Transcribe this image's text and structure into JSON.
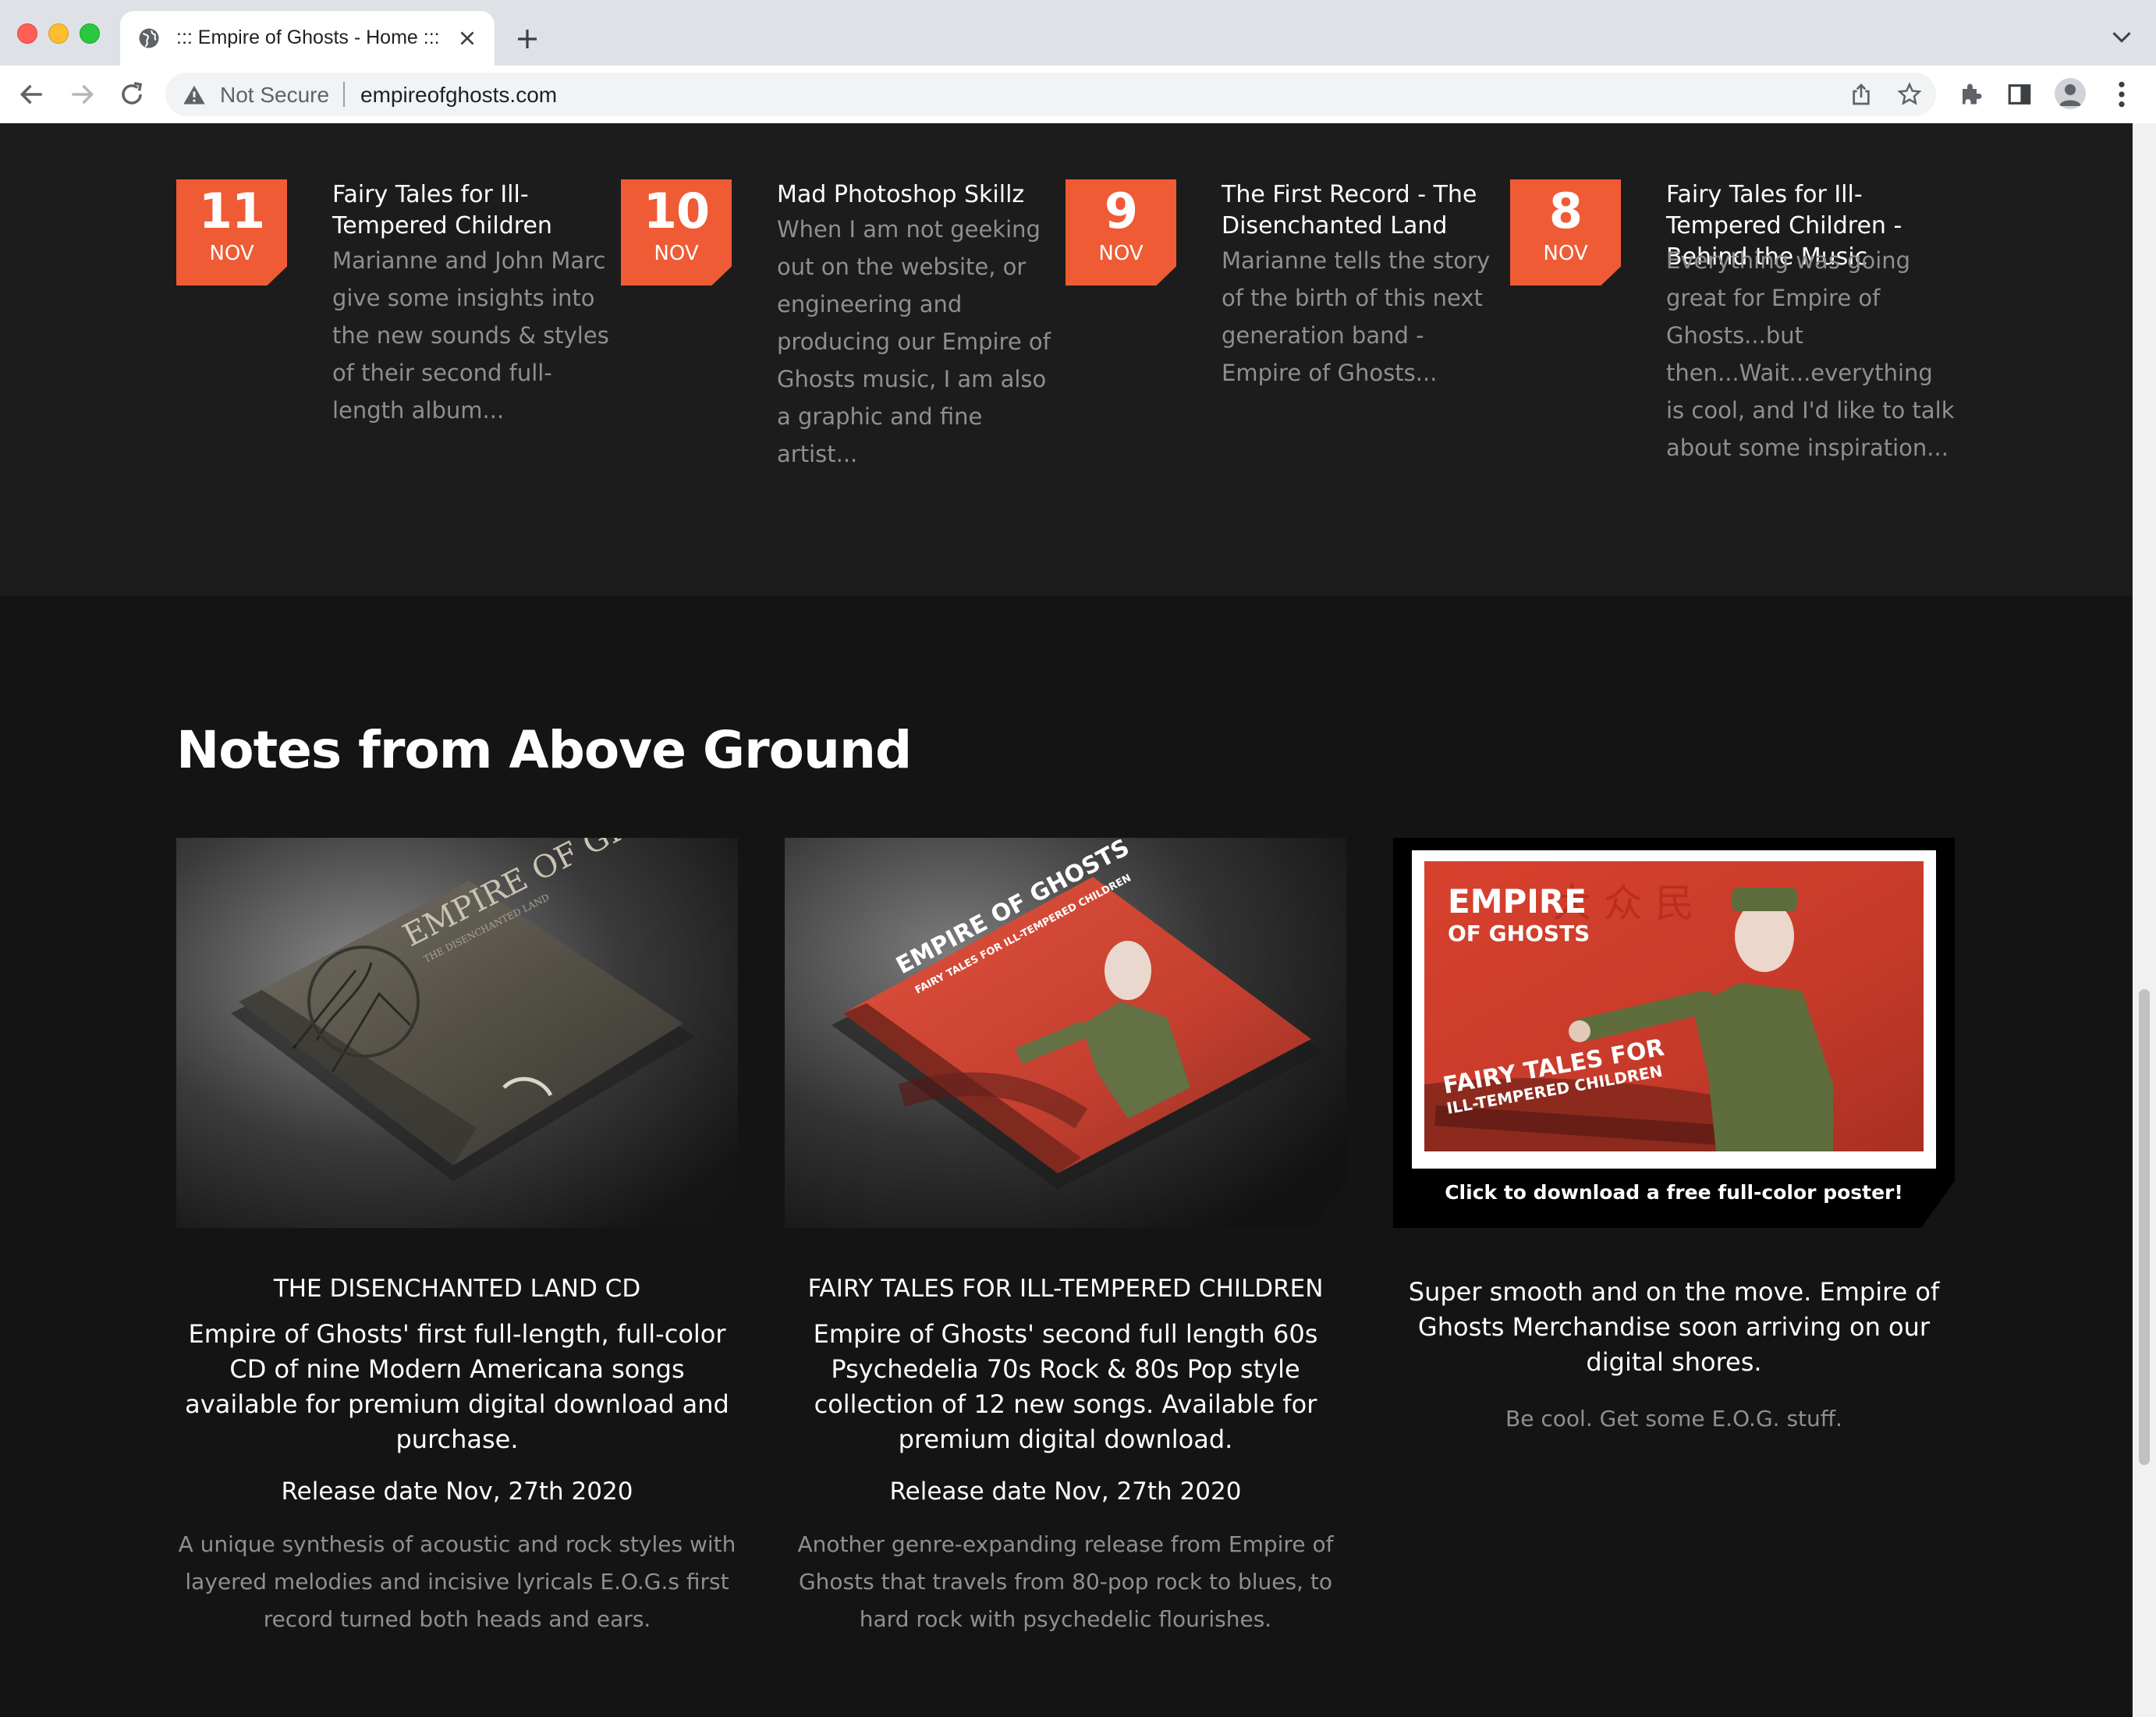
{
  "browser": {
    "tab_title": "::: Empire of Ghosts - Home :::",
    "security_label": "Not Secure",
    "url": "empireofghosts.com"
  },
  "posts": [
    {
      "day": "11",
      "month": "NOV",
      "title": "Fairy Tales for Ill-Tempered Children",
      "excerpt": "Marianne and John Marc give some insights into the new sounds & styles of their second full-length album..."
    },
    {
      "day": "10",
      "month": "NOV",
      "title": "Mad Photoshop Skillz",
      "excerpt": "When I am not geeking out on the website, or engineering and producing our Empire of Ghosts music, I am also a graphic and fine artist..."
    },
    {
      "day": "9",
      "month": "NOV",
      "title": "The First Record - The Disenchanted Land",
      "excerpt": "Marianne tells the story of the birth of this next generation band - Empire of Ghosts..."
    },
    {
      "day": "8",
      "month": "NOV",
      "title": "Fairy Tales for Ill-Tempered Children - Behind the Music",
      "excerpt": "Everything was going great for Empire of Ghosts...but then...Wait...everything is cool, and I'd like to talk about some inspiration..."
    }
  ],
  "notes": {
    "heading": "Notes from Above Ground",
    "cards": [
      {
        "name": "THE DISENCHANTED LAND CD",
        "description": "Empire of Ghosts' first full-length, full-color CD of nine Modern Americana songs available for premium digital download and purchase.",
        "release": "Release date Nov, 27th 2020",
        "blurb": "A unique synthesis of acoustic and rock styles with layered melodies and incisive lyricals E.O.G.s first record turned both heads and ears.",
        "cover_text": "EMPIRE OF GHOSTS",
        "cover_subtext": "THE DISENCHANTED LAND"
      },
      {
        "name": "FAIRY TALES FOR ILL-TEMPERED CHILDREN",
        "description": "Empire of Ghosts' second full length 60s Psychedelia 70s Rock & 80s Pop style collection of 12 new songs. Available for premium digital download.",
        "release": "Release date Nov, 27th 2020",
        "blurb": "Another genre-expanding release from Empire of Ghosts that travels from 80-pop rock to blues, to hard rock with psychedelic flourishes.",
        "cover_text": "EMPIRE OF GHOSTS",
        "cover_subtext": "FAIRY TALES FOR ILL-TEMPERED CHILDREN"
      },
      {
        "poster_title_1": "EMPIRE",
        "poster_title_2": "OF GHOSTS",
        "poster_sub_1": "FAIRY TALES FOR",
        "poster_sub_2": "ILL-TEMPERED CHILDREN",
        "poster_caption": "Click to download a free full-color poster!",
        "description": "Super smooth and on the move. Empire of Ghosts Merchandise soon arriving on our digital shores.",
        "blurb": "Be cool. Get some E.O.G. stuff."
      }
    ]
  },
  "colors": {
    "accent": "#ef5b34",
    "page_bg": "#141414",
    "band_bg": "#1c1c1c",
    "muted_text": "#8f8f8f"
  }
}
